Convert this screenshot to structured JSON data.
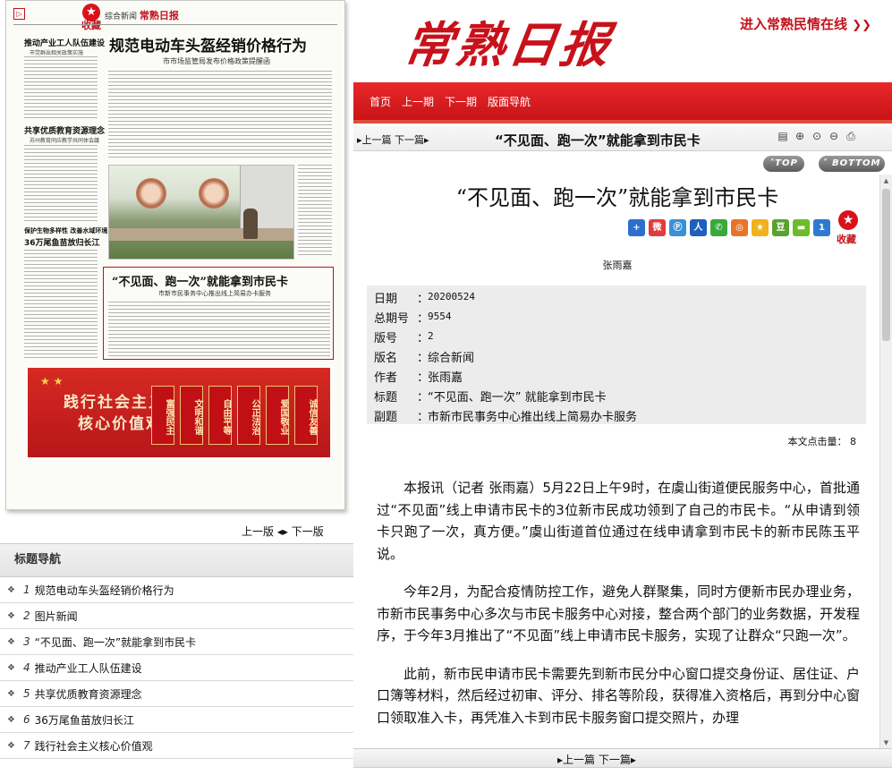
{
  "left": {
    "favorite_label": "收藏",
    "paper": {
      "masthead_section": "综合新闻",
      "masthead_logo": "常熟日报",
      "headline": "规范电动车头盔经销价格行为",
      "subheadline": "市市场监管局发布价格政策提醒函",
      "side_headline_1": "推动产业工人队伍建设",
      "side_sub_1": "市党群出相关政策实施",
      "side_headline_2": "共享优质教育资源理念",
      "side_sub_2": "苏州教育同应教学共同体会議",
      "side_headline_3a": "保护生物多样性 改善水域环境",
      "side_headline_3b": "36万尾鱼苗放归长江",
      "headline_2": "“不见面、跑一次”就能拿到市民卡",
      "subheadline_2": "市新市民事务中心推出线上简易办卡服务",
      "banner_line_1": "践行社会主义",
      "banner_line_2": "核心价值观",
      "banner_tags": [
        "富强民主",
        "文明和谐",
        "自由平等",
        "公正法治",
        "爱国敬业",
        "诚信友善"
      ]
    },
    "page_nav": {
      "prev": "上一版",
      "next": "下一版"
    },
    "title_nav": {
      "header": "标题导航",
      "items": [
        {
          "num": "1",
          "title": "规范电动车头盔经销价格行为"
        },
        {
          "num": "2",
          "title": "图片新闻"
        },
        {
          "num": "3",
          "title": "“不见面、跑一次”就能拿到市民卡"
        },
        {
          "num": "4",
          "title": "推动产业工人队伍建设"
        },
        {
          "num": "5",
          "title": "共享优质教育资源理念"
        },
        {
          "num": "6",
          "title": "36万尾鱼苗放归长江"
        },
        {
          "num": "7",
          "title": "践行社会主义核心价值观"
        }
      ]
    }
  },
  "right": {
    "logo": "常熟日报",
    "enter_link": "进入常熟民情在线",
    "nav": [
      "首页",
      "上一期",
      "下一期",
      "版面导航"
    ],
    "article_bar": {
      "prev": "上一篇",
      "next": "下一篇",
      "title": "“不见面、跑一次”就能拿到市民卡"
    },
    "top_button": "TOP",
    "bottom_button": "BOTTOM",
    "article": {
      "title": "“不见面、跑一次”就能拿到市民卡",
      "favorite_label": "收藏",
      "author": "张雨嘉",
      "meta": [
        {
          "key": "日期",
          "value": "20200524"
        },
        {
          "key": "总期号",
          "value": "9554"
        },
        {
          "key": "版号",
          "value": "2"
        },
        {
          "key": "版名",
          "value": "综合新闻"
        },
        {
          "key": "作者",
          "value": "张雨嘉"
        },
        {
          "key": "标题",
          "value": "“不见面、跑一次” 就能拿到市民卡"
        },
        {
          "key": "副题",
          "value": "市新市民事务中心推出线上简易办卡服务"
        }
      ],
      "hits_label": "本文点击量：",
      "hits_value": "8",
      "paragraphs": [
        "本报讯（记者 张雨嘉）5月22日上午9时，在虞山街道便民服务中心，首批通过“不见面”线上申请市民卡的3位新市民成功领到了自己的市民卡。“从申请到领卡只跑了一次，真方便。”虞山街道首位通过在线申请拿到市民卡的新市民陈玉平说。",
        "今年2月，为配合疫情防控工作，避免人群聚集，同时方便新市民办理业务，市新市民事务中心多次与市民卡服务中心对接，整合两个部门的业务数据，开发程序，于今年3月推出了“不见面”线上申请市民卡服务，实现了让群众“只跑一次”。",
        "此前，新市民申请市民卡需要先到新市民分中心窗口提交身份证、居住证、户口簿等材料，然后经过初审、评分、排名等阶段，获得准入资格后，再到分中心窗口领取准入卡，再凭准入卡到市民卡服务窗口提交照片，办理"
      ]
    },
    "bottom_nav": {
      "prev": "上一篇",
      "next": "下一篇"
    }
  }
}
